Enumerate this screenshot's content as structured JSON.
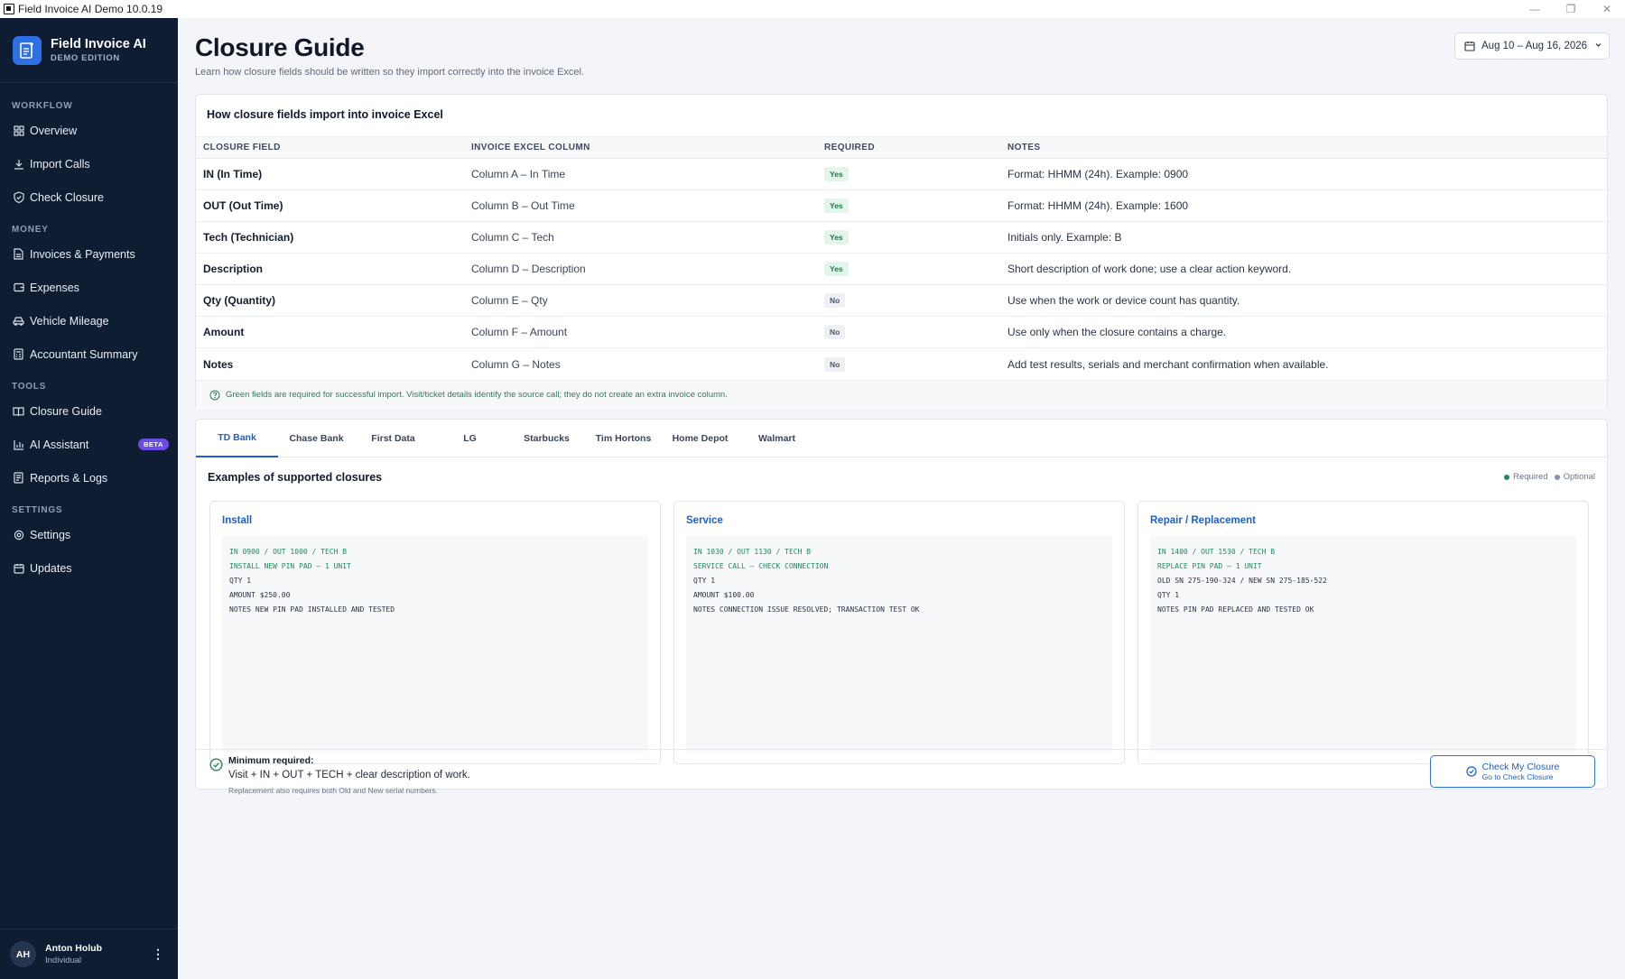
{
  "window": {
    "title": "Field Invoice AI Demo 10.0.19"
  },
  "brand": {
    "name": "Field Invoice AI",
    "edition": "DEMO EDITION"
  },
  "sidebar": {
    "sections": [
      {
        "label": "WORKFLOW",
        "items": [
          {
            "label": "Overview",
            "icon": "grid-icon"
          },
          {
            "label": "Import Calls",
            "icon": "download-icon"
          },
          {
            "label": "Check Closure",
            "icon": "shield-check-icon"
          }
        ]
      },
      {
        "label": "MONEY",
        "items": [
          {
            "label": "Invoices & Payments",
            "icon": "document-icon"
          },
          {
            "label": "Expenses",
            "icon": "wallet-icon"
          },
          {
            "label": "Vehicle Mileage",
            "icon": "car-icon"
          },
          {
            "label": "Accountant Summary",
            "icon": "calculator-icon"
          }
        ]
      },
      {
        "label": "TOOLS",
        "items": [
          {
            "label": "Closure Guide",
            "icon": "book-icon",
            "active": true
          },
          {
            "label": "AI Assistant",
            "icon": "chart-icon",
            "badge": "BETA"
          },
          {
            "label": "Reports & Logs",
            "icon": "report-icon"
          }
        ]
      },
      {
        "label": "SETTINGS",
        "items": [
          {
            "label": "Settings",
            "icon": "gear-icon"
          },
          {
            "label": "Updates",
            "icon": "calendar-icon"
          }
        ]
      }
    ]
  },
  "user": {
    "initials": "AH",
    "name": "Anton Holub",
    "role": "Individual"
  },
  "header": {
    "title": "Closure Guide",
    "subtitle": "Learn how closure fields should be written so they import correctly into the invoice Excel.",
    "date_range": "Aug 10 – Aug 16, 2026"
  },
  "import_table": {
    "title": "How closure fields import into invoice Excel",
    "columns": [
      "CLOSURE FIELD",
      "INVOICE EXCEL COLUMN",
      "REQUIRED",
      "NOTES"
    ],
    "rows": [
      {
        "field": "IN (In Time)",
        "column": "Column A – In Time",
        "required": "Yes",
        "notes": "Format: HHMM (24h). Example: 0900"
      },
      {
        "field": "OUT (Out Time)",
        "column": "Column B – Out Time",
        "required": "Yes",
        "notes": "Format: HHMM (24h). Example: 1600"
      },
      {
        "field": "Tech (Technician)",
        "column": "Column C – Tech",
        "required": "Yes",
        "notes": "Initials only. Example: B"
      },
      {
        "field": "Description",
        "column": "Column D – Description",
        "required": "Yes",
        "notes": "Short description of work done; use a clear action keyword."
      },
      {
        "field": "Qty (Quantity)",
        "column": "Column E – Qty",
        "required": "No",
        "notes": "Use when the work or device count has quantity."
      },
      {
        "field": "Amount",
        "column": "Column F – Amount",
        "required": "No",
        "notes": "Use only when the closure contains a charge."
      },
      {
        "field": "Notes",
        "column": "Column G – Notes",
        "required": "No",
        "notes": "Add test results, serials and merchant confirmation when available."
      }
    ],
    "footnote": "Green fields are required for successful import. Visit/ticket details identify the source call; they do not create an extra invoice column."
  },
  "examples": {
    "tabs": [
      "TD Bank",
      "Chase Bank",
      "First Data",
      "LG",
      "Starbucks",
      "Tim Hortons",
      "Home Depot",
      "Walmart"
    ],
    "active_tab": "TD Bank",
    "title": "Examples of supported closures",
    "legend": {
      "required": "Required",
      "optional": "Optional"
    },
    "cards": [
      {
        "name": "Install",
        "lines": [
          {
            "text": "IN 0900 / OUT 1000 / TECH B",
            "kind": "req"
          },
          {
            "text": "INSTALL NEW PIN PAD – 1 UNIT",
            "kind": "req"
          },
          {
            "text": "QTY 1",
            "kind": "opt"
          },
          {
            "text": "AMOUNT $250.00",
            "kind": "opt"
          },
          {
            "text": "NOTES NEW PIN PAD INSTALLED AND TESTED",
            "kind": "opt"
          }
        ]
      },
      {
        "name": "Service",
        "lines": [
          {
            "text": "IN 1030 / OUT 1130 / TECH B",
            "kind": "req"
          },
          {
            "text": "SERVICE CALL – CHECK CONNECTION",
            "kind": "req"
          },
          {
            "text": "QTY 1",
            "kind": "opt"
          },
          {
            "text": "AMOUNT $100.00",
            "kind": "opt"
          },
          {
            "text": "NOTES CONNECTION ISSUE RESOLVED; TRANSACTION TEST OK",
            "kind": "opt"
          }
        ]
      },
      {
        "name": "Repair / Replacement",
        "lines": [
          {
            "text": "IN 1400 / OUT 1530 / TECH B",
            "kind": "req"
          },
          {
            "text": "REPLACE PIN PAD – 1 UNIT",
            "kind": "req"
          },
          {
            "text": "OLD SN 275-190-324 / NEW SN 275-185-522",
            "kind": "opt"
          },
          {
            "text": "QTY 1",
            "kind": "opt"
          },
          {
            "text": "NOTES PIN PAD REPLACED AND TESTED OK",
            "kind": "opt"
          }
        ]
      }
    ],
    "minimum": {
      "title": "Minimum required:",
      "text": "Visit + IN + OUT + TECH + clear description of work.",
      "sub": "Replacement also requires both Old and New serial numbers."
    },
    "check_button": {
      "label": "Check My Closure",
      "sub": "Go to Check Closure"
    }
  },
  "colors": {
    "sidebar_bg": "#0f1d33",
    "accent": "#1f5fc9",
    "required_green": "#1f8a5a",
    "beta_purple": "#6b4de6"
  }
}
